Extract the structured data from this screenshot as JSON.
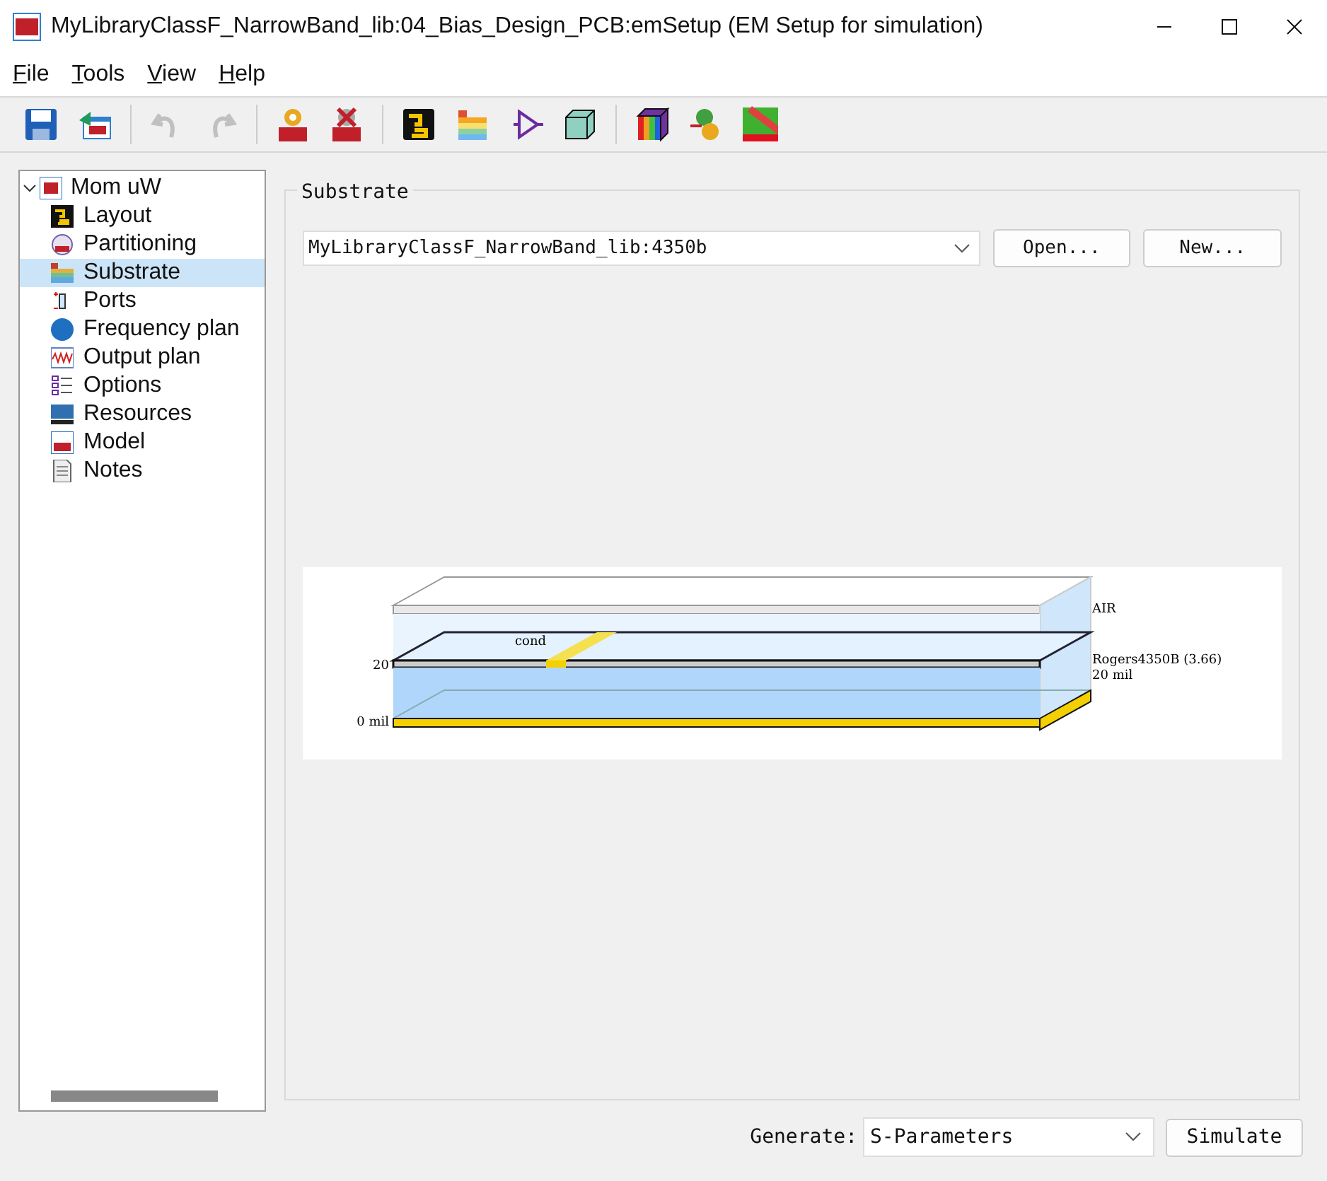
{
  "window": {
    "title": "MyLibraryClassF_NarrowBand_lib:04_Bias_Design_PCB:emSetup (EM Setup for simulation)"
  },
  "menu": [
    "File",
    "Tools",
    "View",
    "Help"
  ],
  "toolbar": [
    {
      "disabled": false
    },
    {
      "disabled": false
    },
    {
      "disabled": true
    },
    {
      "disabled": true
    },
    {
      "disabled": false
    },
    {
      "disabled": false
    },
    {
      "disabled": false
    },
    {
      "disabled": false
    },
    {
      "disabled": false
    },
    {
      "disabled": false
    },
    {
      "disabled": false
    },
    {
      "disabled": false
    },
    {
      "disabled": false
    }
  ],
  "tree": {
    "label": "Mom uW",
    "expanded": true,
    "selected": false,
    "children": [
      {
        "label": "Layout",
        "selected": false
      },
      {
        "label": "Partitioning",
        "selected": false
      },
      {
        "label": "Substrate",
        "selected": true
      },
      {
        "label": "Ports",
        "selected": false
      },
      {
        "label": "Frequency plan",
        "selected": false
      },
      {
        "label": "Output plan",
        "selected": false
      },
      {
        "label": "Options",
        "selected": false
      },
      {
        "label": "Resources",
        "selected": false
      },
      {
        "label": "Model",
        "selected": false
      },
      {
        "label": "Notes",
        "selected": false
      }
    ]
  },
  "substrate": {
    "title": "Substrate",
    "value": "MyLibraryClassF_NarrowBand_lib:4350b",
    "buttons": [
      "Open...",
      "New..."
    ],
    "diagram": {
      "top_label": "AIR",
      "conductor_label": "cond",
      "left_labels": [
        "20",
        "0 mil"
      ],
      "right_labels": [
        "Rogers4350B (3.66)",
        "20 mil"
      ]
    }
  },
  "footer": {
    "label": "Generate:",
    "value": "S-Parameters",
    "button": "Simulate"
  }
}
